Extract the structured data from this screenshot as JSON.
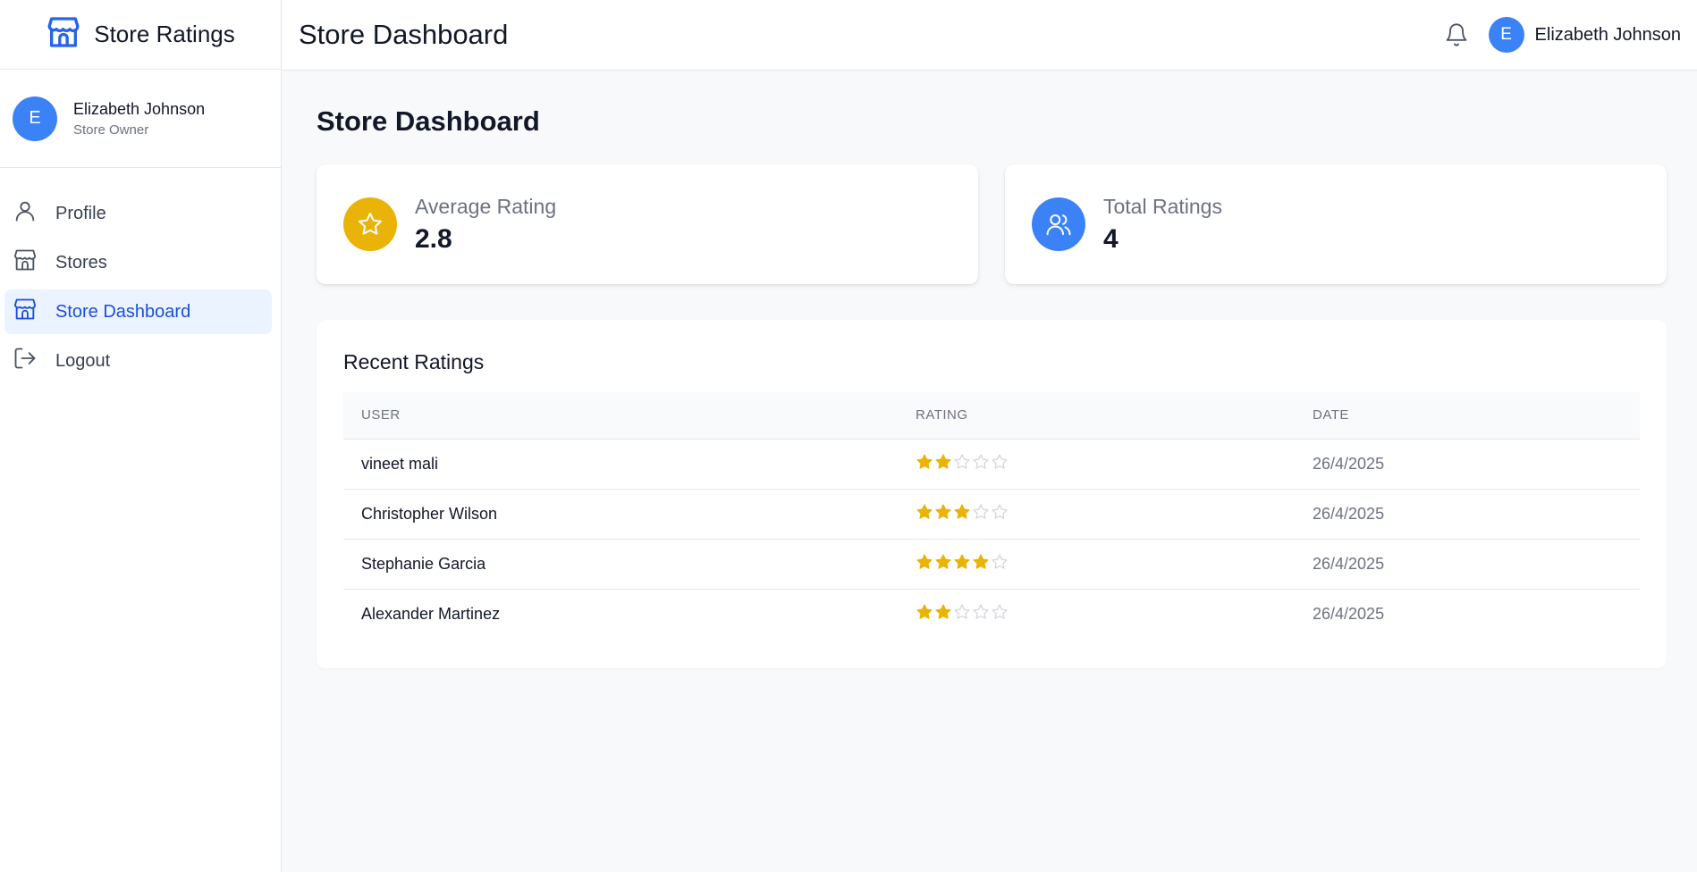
{
  "app": {
    "brand_title": "Store Ratings"
  },
  "sidebar": {
    "user": {
      "initial": "E",
      "name": "Elizabeth Johnson",
      "role": "Store Owner"
    },
    "items": [
      {
        "label": "Profile",
        "icon": "user-icon",
        "active": false
      },
      {
        "label": "Stores",
        "icon": "store-icon",
        "active": false
      },
      {
        "label": "Store Dashboard",
        "icon": "store-icon",
        "active": true
      },
      {
        "label": "Logout",
        "icon": "logout-icon",
        "active": false
      }
    ]
  },
  "header": {
    "title": "Store Dashboard",
    "user_initial": "E",
    "user_name": "Elizabeth Johnson"
  },
  "main": {
    "page_title": "Store Dashboard",
    "stats": [
      {
        "label": "Average Rating",
        "value": "2.8",
        "icon": "star-icon",
        "color": "#eab308"
      },
      {
        "label": "Total Ratings",
        "value": "4",
        "icon": "users-icon",
        "color": "#3b82f6"
      }
    ],
    "recent": {
      "title": "Recent Ratings",
      "columns": [
        "USER",
        "RATING",
        "DATE"
      ],
      "rows": [
        {
          "user": "vineet mali",
          "rating": 2,
          "date": "26/4/2025"
        },
        {
          "user": "Christopher Wilson",
          "rating": 3,
          "date": "26/4/2025"
        },
        {
          "user": "Stephanie Garcia",
          "rating": 4,
          "date": "26/4/2025"
        },
        {
          "user": "Alexander Martinez",
          "rating": 2,
          "date": "26/4/2025"
        }
      ]
    }
  },
  "colors": {
    "accent": "#1d4ed8",
    "avatar": "#3b82f6",
    "star_filled": "#eab308",
    "star_empty": "#d1d5db"
  }
}
